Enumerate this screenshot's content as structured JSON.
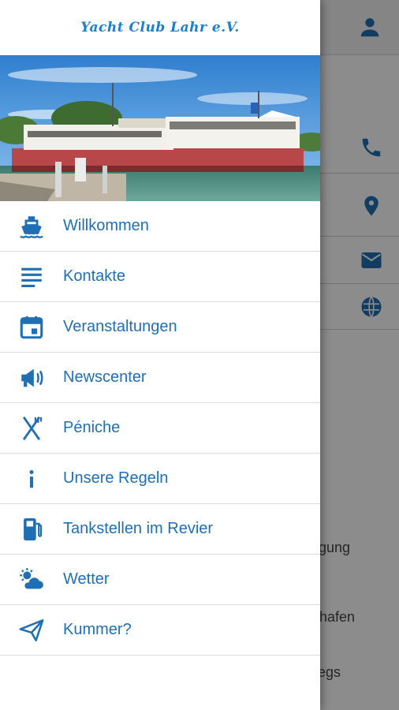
{
  "app": {
    "title": "Yacht Club Lahr e.V.",
    "accent_color": "#1f6fb5"
  },
  "menu": {
    "items": [
      {
        "label": "Willkommen",
        "icon": "ship-icon"
      },
      {
        "label": "Kontakte",
        "icon": "list-lines-icon"
      },
      {
        "label": "Veranstaltungen",
        "icon": "calendar-icon"
      },
      {
        "label": "Newscenter",
        "icon": "megaphone-icon"
      },
      {
        "label": "Péniche",
        "icon": "fork-knife-icon"
      },
      {
        "label": "Unsere Regeln",
        "icon": "info-icon"
      },
      {
        "label": "Tankstellen im Revier",
        "icon": "fuel-pump-icon"
      },
      {
        "label": "Wetter",
        "icon": "weather-icon"
      },
      {
        "label": "Kummer?",
        "icon": "paper-plane-icon"
      }
    ]
  },
  "background": {
    "text_1": "nigung",
    "text_2": "nthafen",
    "text_3": "wegs",
    "icons": [
      "user-icon",
      "phone-icon",
      "location-pin-icon",
      "mail-icon",
      "globe-icon"
    ]
  }
}
